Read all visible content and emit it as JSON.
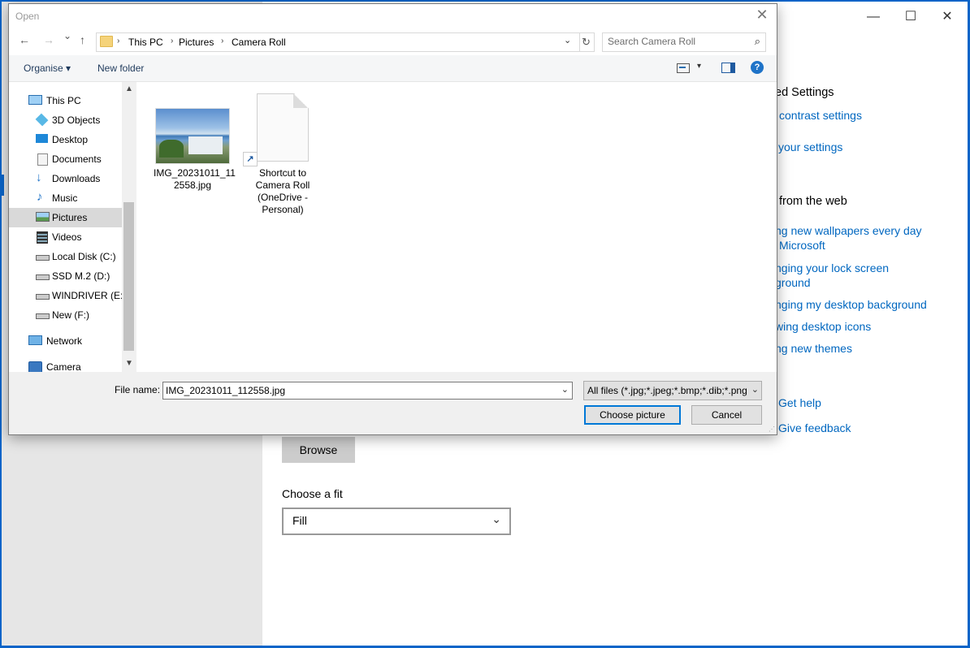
{
  "background_window": {
    "right_panel": {
      "partial_header_1": "ed Settings",
      "partial_link_1": "contrast settings",
      "partial_link_2": "your settings",
      "partial_header_2": "from the web",
      "partial_link_3a": "ng new wallpapers every day",
      "partial_link_3b": "Microsoft",
      "partial_link_4a": "nging your lock screen",
      "partial_link_4b": "ground",
      "partial_link_5": "nging my desktop background",
      "partial_link_6": "wing desktop icons",
      "partial_link_7": "ng new themes",
      "get_help": "Get help",
      "give_feedback": "Give feedback"
    },
    "browse_label": "Browse",
    "fit_label": "Choose a fit",
    "fit_value": "Fill",
    "controls": {
      "minimize": "—",
      "maximize": "☐",
      "close": "✕"
    }
  },
  "dialog": {
    "title": "Open",
    "close_glyph": "✕",
    "nav": {
      "back": "←",
      "forward": "→",
      "recent": "⌄",
      "up": "↑"
    },
    "breadcrumbs": [
      "This PC",
      "Pictures",
      "Camera Roll"
    ],
    "crumb_sep": "›",
    "refresh_glyph": "↻",
    "search_placeholder": "Search Camera Roll",
    "search_icon": "⌕",
    "toolbar": {
      "organise": "Organise ▾",
      "new_folder": "New folder",
      "view_dd": "▾",
      "help": "?"
    },
    "nav_items": [
      {
        "label": "This PC",
        "icon": "monitor-icon",
        "selected": false
      },
      {
        "label": "3D Objects",
        "icon": "cube-icon",
        "selected": false
      },
      {
        "label": "Desktop",
        "icon": "desktop-icon",
        "selected": false
      },
      {
        "label": "Documents",
        "icon": "document-icon",
        "selected": false
      },
      {
        "label": "Downloads",
        "icon": "download-icon",
        "selected": false
      },
      {
        "label": "Music",
        "icon": "music-icon",
        "selected": false
      },
      {
        "label": "Pictures",
        "icon": "pictures-icon",
        "selected": true
      },
      {
        "label": "Videos",
        "icon": "video-icon",
        "selected": false
      },
      {
        "label": "Local Disk (C:)",
        "icon": "drive-icon",
        "selected": false
      },
      {
        "label": "SSD M.2 (D:)",
        "icon": "drive-icon",
        "selected": false
      },
      {
        "label": "WINDRIVER (E:)",
        "icon": "drive-icon",
        "selected": false
      },
      {
        "label": "New (F:)",
        "icon": "drive-icon",
        "selected": false
      },
      {
        "label": "Network",
        "icon": "network-icon",
        "selected": false
      },
      {
        "label": "Camera",
        "icon": "camera-icon",
        "selected": false
      }
    ],
    "files": [
      {
        "name_line1": "IMG_20231011_11",
        "name_line2": "2558.jpg",
        "type": "image"
      },
      {
        "name_line1": "Shortcut to",
        "name_line2": "Camera Roll",
        "name_line3": "(OneDrive -",
        "name_line4": "Personal)",
        "type": "shortcut"
      }
    ],
    "file_name_label": "File name:",
    "file_name_value": "IMG_20231011_112558.jpg",
    "filter_value": "All files (*.jpg;*.jpeg;*.bmp;*.dib;*.png;*.gif)",
    "choose_button": "Choose picture",
    "cancel_button": "Cancel",
    "dropdown_glyph": "⌄",
    "scroll_up": "▲",
    "scroll_down": "▼"
  }
}
